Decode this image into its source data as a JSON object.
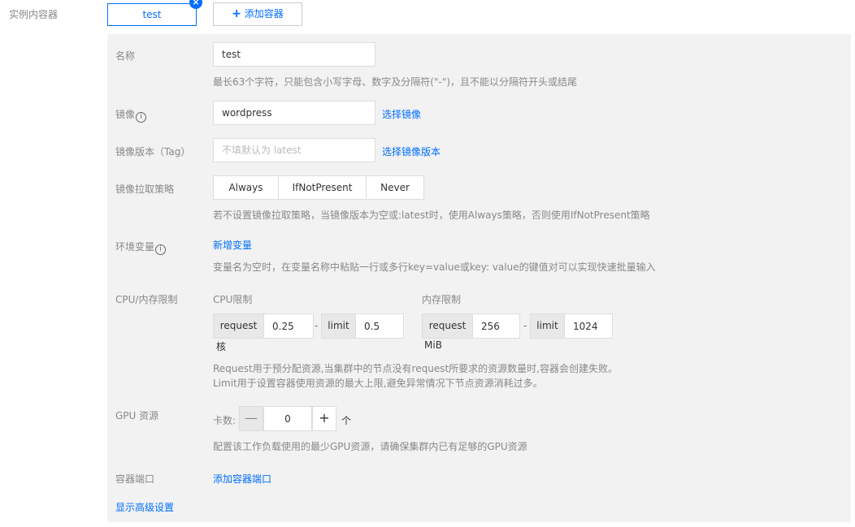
{
  "top": {
    "label": "实例内容器",
    "tab_name": "test",
    "add_container": "添加容器"
  },
  "form": {
    "name_label": "名称",
    "name_value": "test",
    "name_help": "最长63个字符，只能包含小写字母、数字及分隔符(\"-\")，且不能以分隔符开头或结尾",
    "image_label": "镜像",
    "image_value": "wordpress",
    "image_select": "选择镜像",
    "tag_label": "镜像版本（Tag）",
    "tag_placeholder": "不填默认为 latest",
    "tag_select": "选择镜像版本",
    "pull_label": "镜像拉取策略",
    "pull_options": [
      "Always",
      "IfNotPresent",
      "Never"
    ],
    "pull_help": "若不设置镜像拉取策略，当镜像版本为空或:latest时，使用Always策略，否则使用IfNotPresent策略",
    "env_label": "环境变量",
    "env_add": "新增变量",
    "env_help": "变量名为空时，在变量名称中粘贴一行或多行key=value或key: value的键值对可以实现快速批量输入",
    "limit_label": "CPU/内存限制",
    "cpu_title": "CPU限制",
    "cpu_request_label": "request",
    "cpu_request_value": "0.25",
    "cpu_dash": "-",
    "cpu_limit_label": "limit",
    "cpu_limit_value": "0.5",
    "cpu_unit": "核",
    "mem_title": "内存限制",
    "mem_request_label": "request",
    "mem_request_value": "256",
    "mem_dash": "-",
    "mem_limit_label": "limit",
    "mem_limit_value": "1024",
    "mem_unit": "MiB",
    "limit_help1": "Request用于预分配资源,当集群中的节点没有request所要求的资源数量时,容器会创建失败。",
    "limit_help2": "Limit用于设置容器使用资源的最大上限,避免异常情况下节点资源消耗过多。",
    "gpu_label": "GPU 资源",
    "gpu_count_label": "卡数:",
    "gpu_minus": "—",
    "gpu_value": "0",
    "gpu_plus": "+",
    "gpu_unit": "个",
    "gpu_help": "配置该工作负载使用的最少GPU资源，请确保集群内已有足够的GPU资源",
    "port_label": "容器端口",
    "port_add": "添加容器端口",
    "advanced": "显示高级设置"
  },
  "colors": {
    "accent": "#006eff",
    "panel_bg": "#f2f2f2"
  }
}
